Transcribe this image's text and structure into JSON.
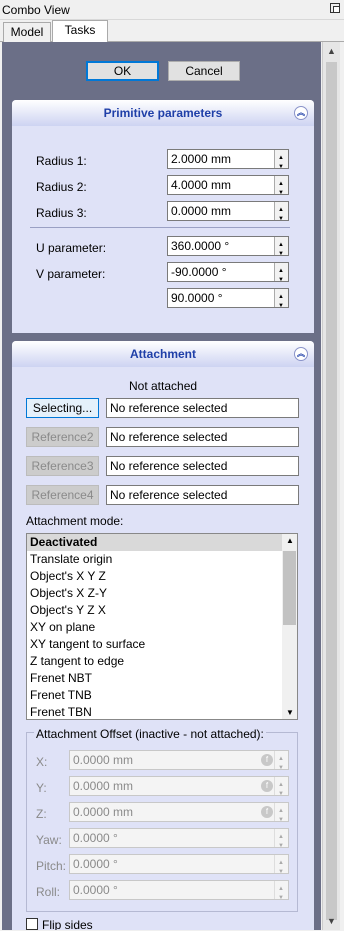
{
  "window": {
    "title": "Combo View"
  },
  "tabs": [
    {
      "label": "Model"
    },
    {
      "label": "Tasks"
    }
  ],
  "dialog": {
    "ok": "OK",
    "cancel": "Cancel"
  },
  "primitive": {
    "title": "Primitive parameters",
    "radius1": {
      "label": "Radius 1:",
      "value": "2.0000 mm"
    },
    "radius2": {
      "label": "Radius 2:",
      "value": "4.0000 mm"
    },
    "radius3": {
      "label": "Radius 3:",
      "value": "0.0000 mm"
    },
    "u": {
      "label": "U parameter:",
      "value": "360.0000 °"
    },
    "v": {
      "label": "V parameter:",
      "value": "-90.0000 °",
      "value2": "90.0000 °"
    }
  },
  "attachment": {
    "title": "Attachment",
    "status": "Not attached",
    "refs": [
      {
        "button": "Selecting...",
        "value": "No reference selected"
      },
      {
        "button": "Reference2",
        "value": "No reference selected"
      },
      {
        "button": "Reference3",
        "value": "No reference selected"
      },
      {
        "button": "Reference4",
        "value": "No reference selected"
      }
    ],
    "mode_label": "Attachment mode:",
    "modes": [
      "Deactivated",
      "Translate origin",
      "Object's  X Y Z",
      "Object's  X Z-Y",
      "Object's  Y Z X",
      "XY on plane",
      "XY tangent to surface",
      "Z tangent to edge",
      "Frenet NBT",
      "Frenet TNB",
      "Frenet TBN"
    ],
    "offset_title": "Attachment Offset (inactive - not attached):",
    "offset": [
      {
        "label": "X:",
        "value": "0.0000 mm"
      },
      {
        "label": "Y:",
        "value": "0.0000 mm"
      },
      {
        "label": "Z:",
        "value": "0.0000 mm"
      },
      {
        "label": "Yaw:",
        "value": "0.0000 °"
      },
      {
        "label": "Pitch:",
        "value": "0.0000 °"
      },
      {
        "label": "Roll:",
        "value": "0.0000 °"
      }
    ],
    "flip_label": "Flip sides"
  }
}
